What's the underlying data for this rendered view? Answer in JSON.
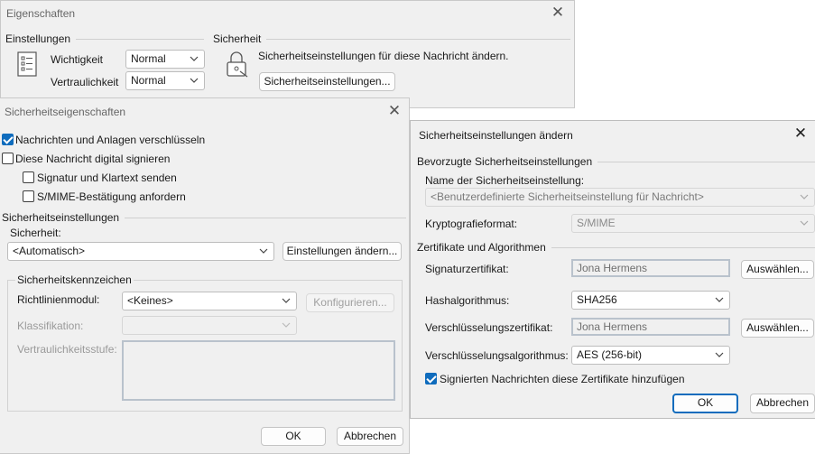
{
  "main": {
    "title": "Eigenschaften",
    "settings_header": "Einstellungen",
    "security_header": "Sicherheit",
    "importance_label": "Wichtigkeit",
    "importance_value": "Normal",
    "sensitivity_label": "Vertraulichkeit",
    "sensitivity_value": "Normal",
    "security_text": "Sicherheitseinstellungen für diese Nachricht ändern.",
    "security_button": "Sicherheitseinstellungen...",
    "close_glyph": "✕"
  },
  "props": {
    "title": "Sicherheitseigenschaften",
    "encrypt_label": "Nachrichten und Anlagen verschlüsseln",
    "encrypt_checked": true,
    "sign_label": "Diese Nachricht digital signieren",
    "sign_checked": false,
    "cleartext_label": "Signatur und Klartext senden",
    "smime_label": "S/MIME-Bestätigung anfordern",
    "settings_header": "Sicherheitseinstellungen",
    "security_label": "Sicherheit:",
    "security_value": "<Automatisch>",
    "change_button": "Einstellungen ändern...",
    "labels_header": "Sicherheitskennzeichen",
    "policy_label": "Richtlinienmodul:",
    "policy_value": "<Keines>",
    "configure_button": "Konfigurieren...",
    "classification_label": "Klassifikation:",
    "privacy_label": "Vertraulichkeitsstufe:",
    "ok_button": "OK",
    "cancel_button": "Abbrechen",
    "close_glyph": "✕"
  },
  "change": {
    "title": "Sicherheitseinstellungen ändern",
    "preferred_header": "Bevorzugte Sicherheitseinstellungen",
    "name_label": "Name der Sicherheitseinstellung:",
    "name_value": "<Benutzerdefinierte Sicherheitseinstellung für Nachricht>",
    "crypto_label": "Kryptografieformat:",
    "crypto_value": "S/MIME",
    "certs_header": "Zertifikate und Algorithmen",
    "sigcert_label": "Signaturzertifikat:",
    "sigcert_value": "Jona Hermens",
    "choose_button": "Auswählen...",
    "hash_label": "Hashalgorithmus:",
    "hash_value": "SHA256",
    "enccert_label": "Verschlüsselungszertifikat:",
    "enccert_value": "Jona Hermens",
    "choose_button2": "Auswählen...",
    "encalg_label": "Verschlüsselungsalgorithmus:",
    "encalg_value": "AES (256-bit)",
    "add_certs_label": "Signierten Nachrichten diese Zertifikate hinzufügen",
    "add_certs_checked": true,
    "ok_button": "OK",
    "cancel_button": "Abbrechen",
    "close_glyph": "✕"
  }
}
